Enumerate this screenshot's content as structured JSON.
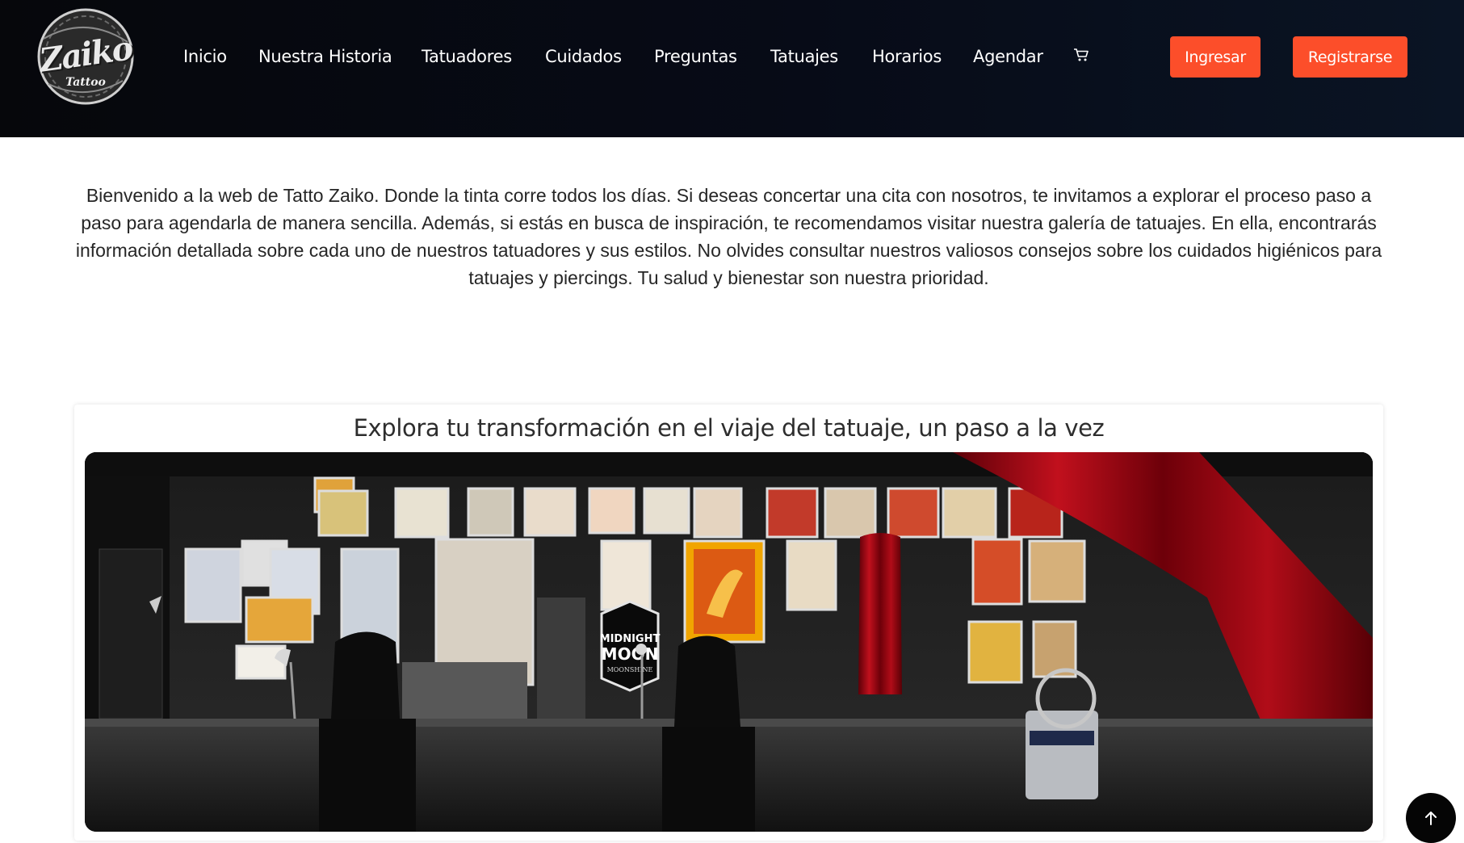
{
  "header": {
    "logo_text": "Zaiko",
    "logo_subtext": "Tattoo",
    "nav": [
      {
        "label": "Inicio"
      },
      {
        "label": "Nuestra Historia"
      },
      {
        "label": "Tatuadores"
      },
      {
        "label": "Cuidados"
      },
      {
        "label": "Preguntas"
      },
      {
        "label": "Tatuajes"
      },
      {
        "label": "Horarios"
      },
      {
        "label": "Agendar"
      }
    ],
    "cart_icon": "cart-icon",
    "login_label": "Ingresar",
    "register_label": "Registrarse",
    "accent_color": "#fc4e2a"
  },
  "intro": {
    "text": "Bienvenido a la web de Tatto Zaiko. Donde la tinta corre todos los días. Si deseas concertar una cita con nosotros, te invitamos a explorar el proceso paso a paso para agendarla de manera sencilla. Además, si estás en busca de inspiración, te recomendamos visitar nuestra galería de tatuajes. En ella, encontrarás información detallada sobre cada uno de nuestros tatuadores y sus estilos. No olvides consultar nuestros valiosos consejos sobre los cuidados higiénicos para tatuajes y piercings. Tu salud y bienestar son nuestra prioridad."
  },
  "card": {
    "title": "Explora tu transformación en el viaje del tatuaje, un paso a la vez",
    "photo_sign_line1": "MIDNIGHT",
    "photo_sign_line2": "MOON",
    "photo_sign_line3": "MOONSHINE"
  },
  "back_to_top_icon": "arrow-up-icon"
}
